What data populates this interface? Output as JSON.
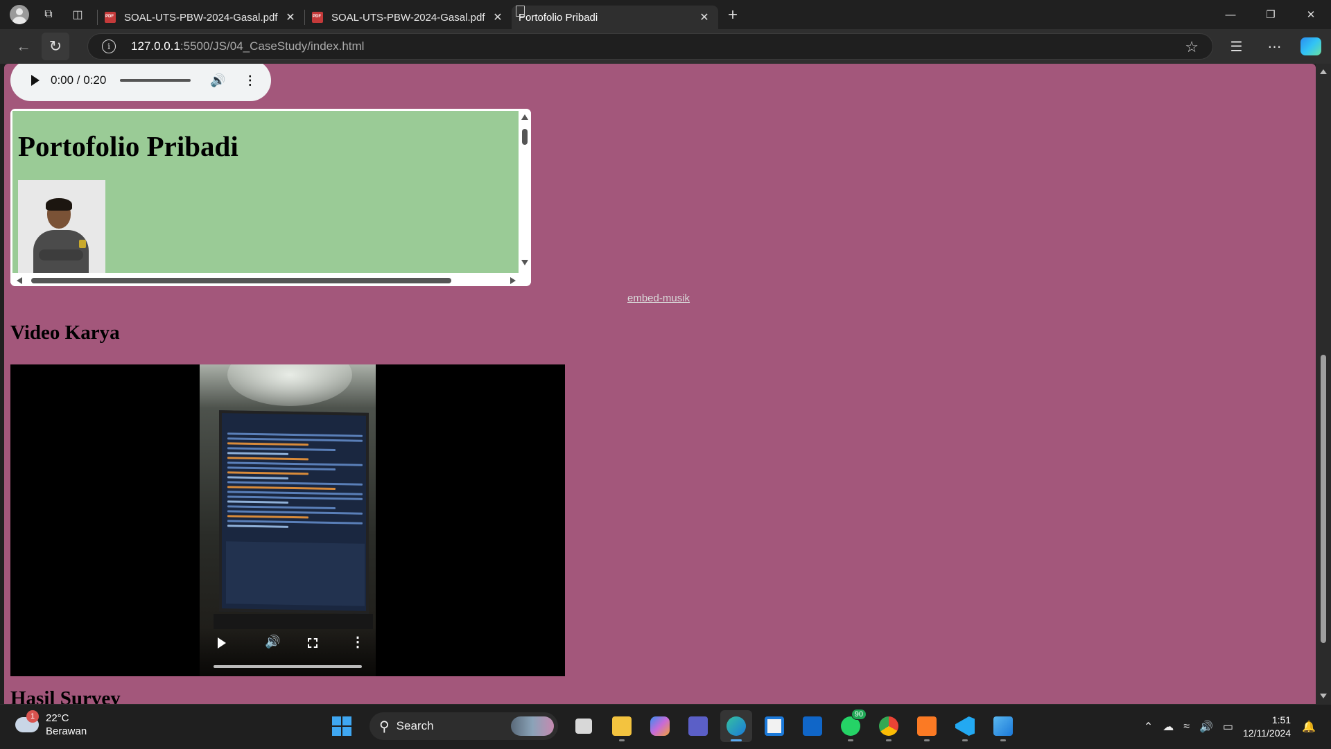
{
  "browser": {
    "tabs": [
      {
        "title": "SOAL-UTS-PBW-2024-Gasal.pdf",
        "icon": "pdf-icon",
        "active": false
      },
      {
        "title": "SOAL-UTS-PBW-2024-Gasal.pdf",
        "icon": "pdf-icon",
        "active": false
      },
      {
        "title": "Portofolio Pribadi",
        "icon": "page-icon",
        "active": true
      }
    ],
    "url_host": "127.0.0.1",
    "url_rest": ":5500/JS/04_CaseStudy/index.html"
  },
  "page": {
    "background": "#a3577b",
    "audio": {
      "time": "0:00 / 0:20"
    },
    "iframe": {
      "heading": "Portofolio Pribadi",
      "background": "#9acb96"
    },
    "embed_link": "embed-musik",
    "video_heading": "Video Karya",
    "next_heading": "Hasil Survey"
  },
  "taskbar": {
    "weather_temp": "22°C",
    "weather_desc": "Berawan",
    "weather_badge": "1",
    "search_label": "Search",
    "whatsapp_badge": "90",
    "time": "1:51",
    "date": "12/11/2024"
  }
}
